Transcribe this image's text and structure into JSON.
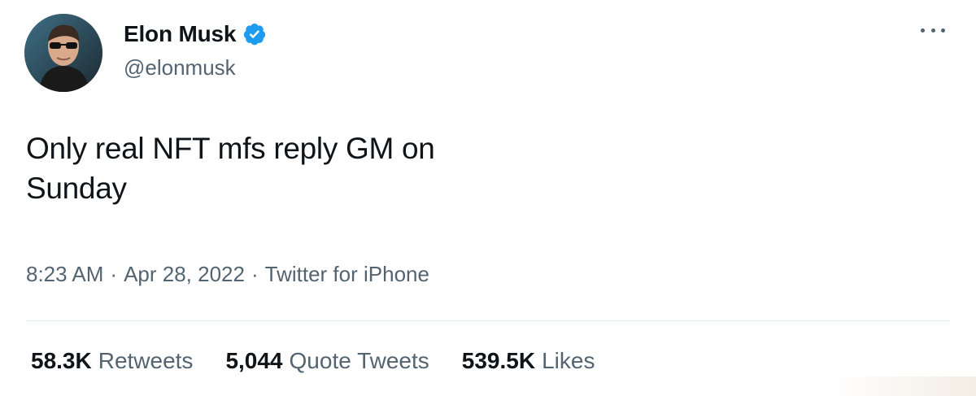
{
  "author": {
    "display_name": "Elon Musk",
    "handle": "@elonmusk",
    "verified": true,
    "avatar_icon": "profile-photo-icon",
    "verified_icon": "verified-badge-icon",
    "verified_color": "#1d9bf0"
  },
  "menu": {
    "icon": "more-options-icon"
  },
  "tweet": {
    "text": "Only real NFT mfs reply GM on Sunday"
  },
  "meta": {
    "time": "8:23 AM",
    "date": "Apr 28, 2022",
    "source": "Twitter for iPhone",
    "separator": "·"
  },
  "stats": [
    {
      "count": "58.3K",
      "label": "Retweets"
    },
    {
      "count": "5,044",
      "label": "Quote Tweets"
    },
    {
      "count": "539.5K",
      "label": "Likes"
    }
  ],
  "colors": {
    "text_primary": "#0f1419",
    "text_secondary": "#536471",
    "divider": "#e6ecf0",
    "accent": "#1d9bf0"
  }
}
